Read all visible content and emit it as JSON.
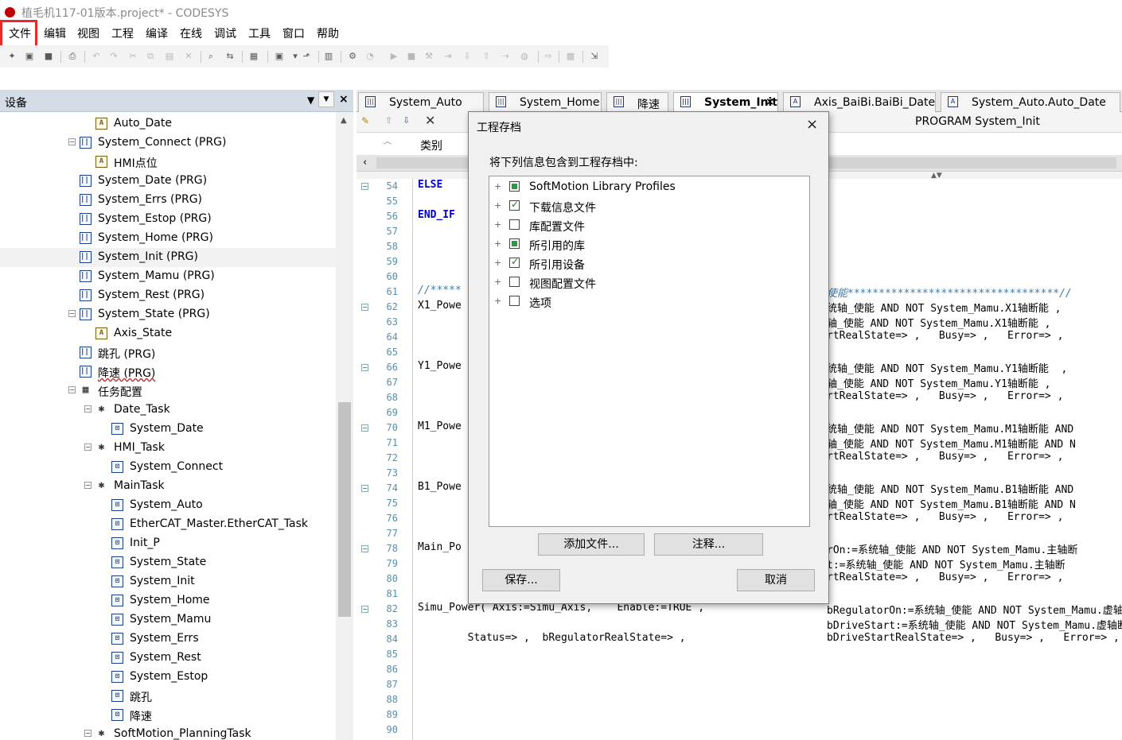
{
  "window": {
    "title": "植毛机117-01版本.project* - CODESYS"
  },
  "menu": [
    "文件",
    "编辑",
    "视图",
    "工程",
    "编译",
    "在线",
    "调试",
    "工具",
    "窗口",
    "帮助"
  ],
  "devices_panel": {
    "title": "设备"
  },
  "tree": [
    {
      "label": "Auto_Date",
      "icon": "object-icon",
      "indent": 5,
      "toggle": ""
    },
    {
      "label": "System_Connect (PRG)",
      "icon": "program-icon",
      "indent": 4,
      "toggle": "−"
    },
    {
      "label": "HMI点位",
      "icon": "object-icon",
      "indent": 5,
      "toggle": ""
    },
    {
      "label": "System_Date (PRG)",
      "icon": "program-icon",
      "indent": 4,
      "toggle": ""
    },
    {
      "label": "System_Errs (PRG)",
      "icon": "program-icon",
      "indent": 4,
      "toggle": ""
    },
    {
      "label": "System_Estop (PRG)",
      "icon": "program-icon",
      "indent": 4,
      "toggle": ""
    },
    {
      "label": "System_Home (PRG)",
      "icon": "program-icon",
      "indent": 4,
      "toggle": ""
    },
    {
      "label": "System_Init (PRG)",
      "icon": "program-icon",
      "indent": 4,
      "toggle": "",
      "selected": true
    },
    {
      "label": "System_Mamu (PRG)",
      "icon": "program-icon",
      "indent": 4,
      "toggle": ""
    },
    {
      "label": "System_Rest (PRG)",
      "icon": "program-icon",
      "indent": 4,
      "toggle": ""
    },
    {
      "label": "System_State (PRG)",
      "icon": "program-icon",
      "indent": 4,
      "toggle": "−"
    },
    {
      "label": "Axis_State",
      "icon": "object-icon",
      "indent": 5,
      "toggle": ""
    },
    {
      "label": "跳孔 (PRG)",
      "icon": "program-icon",
      "indent": 4,
      "toggle": ""
    },
    {
      "label": "降速 (PRG)",
      "icon": "program-icon",
      "indent": 4,
      "toggle": "",
      "wavy": true
    },
    {
      "label": "任务配置",
      "icon": "task-config-icon",
      "indent": 4,
      "toggle": "−"
    },
    {
      "label": "Date_Task",
      "icon": "task-icon",
      "indent": 5,
      "toggle": "−"
    },
    {
      "label": "System_Date",
      "icon": "call-icon",
      "indent": 6,
      "toggle": ""
    },
    {
      "label": "HMI_Task",
      "icon": "task-icon",
      "indent": 5,
      "toggle": "−"
    },
    {
      "label": "System_Connect",
      "icon": "call-icon",
      "indent": 6,
      "toggle": ""
    },
    {
      "label": "MainTask",
      "icon": "task-icon",
      "indent": 5,
      "toggle": "−"
    },
    {
      "label": "System_Auto",
      "icon": "call-icon",
      "indent": 6,
      "toggle": ""
    },
    {
      "label": "EtherCAT_Master.EtherCAT_Task",
      "icon": "call-icon",
      "indent": 6,
      "toggle": ""
    },
    {
      "label": "Init_P",
      "icon": "call-icon",
      "indent": 6,
      "toggle": ""
    },
    {
      "label": "System_State",
      "icon": "call-icon",
      "indent": 6,
      "toggle": ""
    },
    {
      "label": "System_Init",
      "icon": "call-icon",
      "indent": 6,
      "toggle": ""
    },
    {
      "label": "System_Home",
      "icon": "call-icon",
      "indent": 6,
      "toggle": ""
    },
    {
      "label": "System_Mamu",
      "icon": "call-icon",
      "indent": 6,
      "toggle": ""
    },
    {
      "label": "System_Errs",
      "icon": "call-icon",
      "indent": 6,
      "toggle": ""
    },
    {
      "label": "System_Rest",
      "icon": "call-icon",
      "indent": 6,
      "toggle": ""
    },
    {
      "label": "System_Estop",
      "icon": "call-icon",
      "indent": 6,
      "toggle": ""
    },
    {
      "label": "跳孔",
      "icon": "call-icon",
      "indent": 6,
      "toggle": ""
    },
    {
      "label": "降速",
      "icon": "call-icon",
      "indent": 6,
      "toggle": ""
    },
    {
      "label": "SoftMotion_PlanningTask",
      "icon": "task-icon",
      "indent": 5,
      "toggle": "−"
    }
  ],
  "tabs": [
    {
      "label": "System_Auto",
      "icon": "program-icon",
      "active": false
    },
    {
      "label": "System_Home",
      "icon": "program-icon",
      "active": false
    },
    {
      "label": "降速",
      "icon": "program-icon",
      "active": false
    },
    {
      "label": "System_Init",
      "icon": "program-icon",
      "active": true,
      "close": "×"
    },
    {
      "label": "Axis_BaiBi.BaiBi_Date",
      "icon": "object-icon",
      "active": false
    },
    {
      "label": "System_Auto.Auto_Date",
      "icon": "object-icon",
      "active": false
    }
  ],
  "editor": {
    "program_title": "PROGRAM System_Init",
    "category_header": "类别",
    "line_numbers": [
      "54",
      "55",
      "56",
      "57",
      "58",
      "59",
      "60",
      "61",
      "62",
      "63",
      "64",
      "65",
      "66",
      "67",
      "68",
      "69",
      "70",
      "71",
      "72",
      "73",
      "74",
      "75",
      "76",
      "77",
      "78",
      "79",
      "80",
      "81",
      "82",
      "83",
      "84",
      "85",
      "86",
      "87",
      "88",
      "89",
      "90"
    ],
    "code_left": [
      {
        "line": 0,
        "text": "ELSE",
        "kind": "kw"
      },
      {
        "line": 2,
        "text": "END_IF",
        "kind": "kw"
      },
      {
        "line": 7,
        "text": "//*****",
        "kind": "cm"
      },
      {
        "line": 8,
        "text": "X1_Powe",
        "kind": ""
      },
      {
        "line": 12,
        "text": "Y1_Powe",
        "kind": ""
      },
      {
        "line": 16,
        "text": "M1_Powe",
        "kind": ""
      },
      {
        "line": 20,
        "text": "B1_Powe",
        "kind": ""
      },
      {
        "line": 24,
        "text": "Main_Po",
        "kind": ""
      },
      {
        "line": 28,
        "text": "Simu_Power( Axis:=Simu_Axis,    Enable:=TRUE ,",
        "kind": ""
      },
      {
        "line": 30,
        "text": "        Status=> ,  bRegulatorRealState=> ,",
        "kind": ""
      }
    ],
    "code_right": [
      {
        "line": 7,
        "text": "使能**********************************//",
        "kind": "cm"
      },
      {
        "line": 8,
        "text": "统轴_使能 AND NOT System_Mamu.X1轴断能 ,",
        "kind": ""
      },
      {
        "line": 9,
        "text": "轴_使能 AND NOT System_Mamu.X1轴断能 ,",
        "kind": ""
      },
      {
        "line": 10,
        "text": "rtRealState=> ,   Busy=> ,   Error=> ,",
        "kind": ""
      },
      {
        "line": 12,
        "text": "统轴_使能 AND NOT System_Mamu.Y1轴断能  ,",
        "kind": ""
      },
      {
        "line": 13,
        "text": "轴_使能 AND NOT System_Mamu.Y1轴断能 ,",
        "kind": ""
      },
      {
        "line": 14,
        "text": "rtRealState=> ,   Busy=> ,   Error=> ,",
        "kind": ""
      },
      {
        "line": 16,
        "text": "统轴_使能 AND NOT System_Mamu.M1轴断能 AND",
        "kind": ""
      },
      {
        "line": 17,
        "text": "轴_使能 AND NOT System_Mamu.M1轴断能 AND N",
        "kind": ""
      },
      {
        "line": 18,
        "text": "rtRealState=> ,   Busy=> ,   Error=> ,",
        "kind": ""
      },
      {
        "line": 20,
        "text": "统轴_使能 AND NOT System_Mamu.B1轴断能 AND",
        "kind": ""
      },
      {
        "line": 21,
        "text": "轴_使能 AND NOT System_Mamu.B1轴断能 AND N",
        "kind": ""
      },
      {
        "line": 22,
        "text": "rtRealState=> ,   Busy=> ,   Error=> ,",
        "kind": ""
      },
      {
        "line": 24,
        "text": "rOn:=系统轴_使能 AND NOT System_Mamu.主轴断",
        "kind": ""
      },
      {
        "line": 25,
        "text": "t:=系统轴_使能 AND NOT System_Mamu.主轴断",
        "kind": ""
      },
      {
        "line": 26,
        "text": "rtRealState=> ,   Busy=> ,   Error=> ,",
        "kind": ""
      },
      {
        "line": 28,
        "text": "bRegulatorOn:=系统轴_使能 AND NOT System_Mamu.虚轴断",
        "kind": ""
      },
      {
        "line": 29,
        "text": "bDriveStart:=系统轴_使能 AND NOT System_Mamu.虚轴断",
        "kind": ""
      },
      {
        "line": 30,
        "text": "bDriveStartRealState=> ,   Busy=> ,   Error=> ,",
        "kind": ""
      }
    ]
  },
  "dialog": {
    "title": "工程存档",
    "close": "×",
    "label": "将下列信息包含到工程存档中:",
    "items": [
      {
        "label": "SoftMotion Library Profiles",
        "state": "partial"
      },
      {
        "label": "下载信息文件",
        "state": "checked"
      },
      {
        "label": "库配置文件",
        "state": "unchecked"
      },
      {
        "label": "所引用的库",
        "state": "partial"
      },
      {
        "label": "所引用设备",
        "state": "checked"
      },
      {
        "label": "视图配置文件",
        "state": "unchecked"
      },
      {
        "label": "选项",
        "state": "unchecked"
      }
    ],
    "add_file_button": "添加文件...",
    "comment_button": "注释...",
    "save_button": "保存...",
    "cancel_button": "取消"
  },
  "highlight_color": "#e8282a"
}
